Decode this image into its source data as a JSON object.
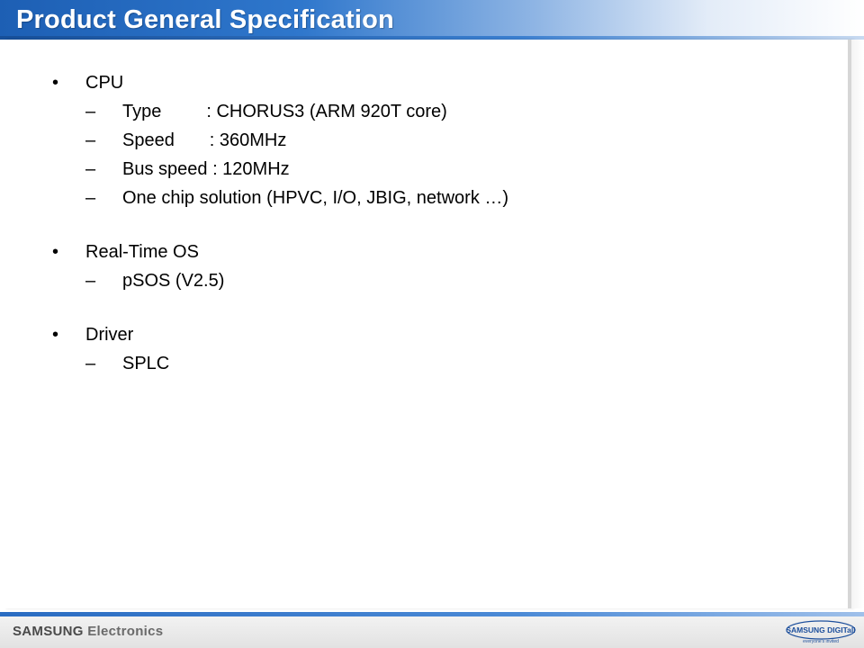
{
  "header": {
    "title": "Product General Specification"
  },
  "content": {
    "sections": [
      {
        "label": "CPU",
        "items": [
          "Type         : CHORUS3 (ARM 920T core)",
          "Speed       : 360MHz",
          "Bus speed : 120MHz",
          "One chip solution (HPVC, I/O, JBIG, network …)"
        ]
      },
      {
        "label": "Real-Time OS",
        "items": [
          "pSOS (V2.5)"
        ]
      },
      {
        "label": "Driver",
        "items": [
          "SPLC"
        ]
      }
    ],
    "bullet_glyph": "•",
    "sub_glyph": "–"
  },
  "footer": {
    "brand_primary": "SAMSUNG",
    "brand_secondary": "Electronics",
    "logo_text": "SAMSUNG DIGITall",
    "logo_tagline": "everyone's invited"
  },
  "colors": {
    "header_blue": "#1d5fb4",
    "footer_accent": "#2a6cc2",
    "text": "#000000"
  },
  "icons": {
    "logo": "samsung-digitall-logo"
  }
}
